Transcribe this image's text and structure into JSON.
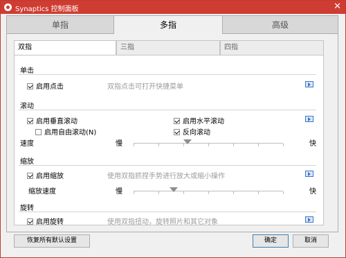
{
  "window": {
    "title": "Synaptics 控制面板",
    "close_glyph": "✕",
    "accent": "#cf3c32"
  },
  "main_tabs": [
    {
      "label": "单指"
    },
    {
      "label": "多指"
    },
    {
      "label": "高级"
    }
  ],
  "sub_tabs": [
    {
      "label": "双指"
    },
    {
      "label": "三指"
    },
    {
      "label": "四指"
    }
  ],
  "sections": {
    "tap": {
      "title": "单击",
      "enable_tap": {
        "label": "启用点击",
        "checked": true
      },
      "description": "双指点击可打开快捷菜单"
    },
    "scroll": {
      "title": "滚动",
      "vertical": {
        "label": "启用垂直滚动",
        "checked": true
      },
      "horizontal": {
        "label": "启用水平滚动",
        "checked": true
      },
      "free": {
        "label": "启用自由滚动(N)",
        "checked": false
      },
      "reverse": {
        "label": "反向滚动",
        "checked": true
      },
      "speed_label": "速度",
      "slow": "慢",
      "fast": "快",
      "speed_value": 0.36
    },
    "zoom": {
      "title": "缩放",
      "enable": {
        "label": "启用缩放",
        "checked": true
      },
      "description": "使用双指抓捏手势进行放大或缩小操作",
      "speed_label": "缩放速度",
      "slow": "慢",
      "fast": "快",
      "speed_value": 0.27
    },
    "rotate": {
      "title": "旋转",
      "enable": {
        "label": "启用旋转",
        "checked": true
      },
      "description": "使用双指扭动，旋转照片和其它对象"
    }
  },
  "buttons": {
    "restore_defaults": "恢复所有默认设置",
    "ok": "确定",
    "cancel": "取消"
  }
}
